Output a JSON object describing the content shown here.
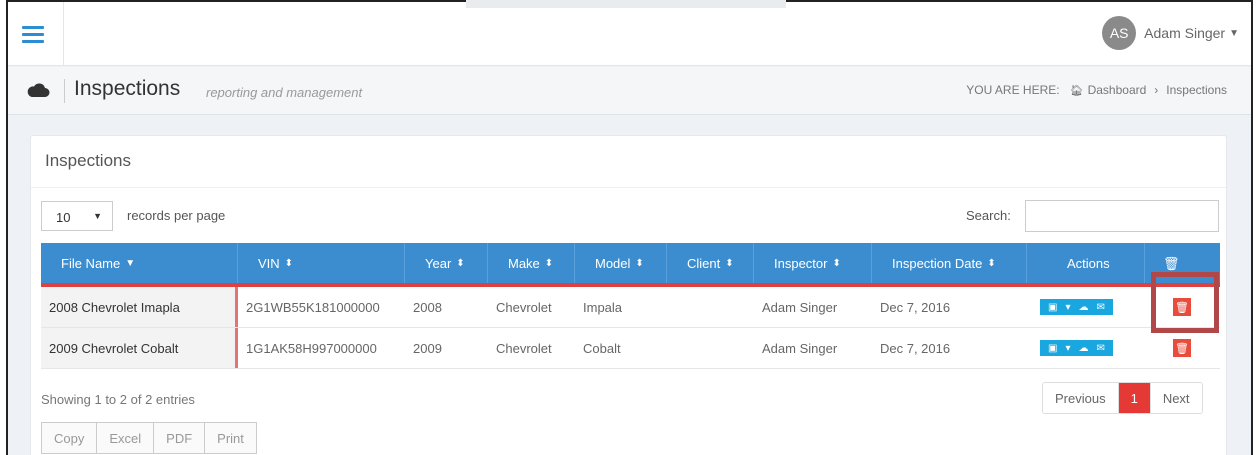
{
  "user": {
    "initials": "AS",
    "name": "Adam Singer"
  },
  "page": {
    "title": "Inspections",
    "subtitle": "reporting and management"
  },
  "breadcrumb": {
    "label": "YOU ARE HERE:",
    "items": [
      "Dashboard",
      "Inspections"
    ],
    "separator": "›"
  },
  "panel": {
    "title": "Inspections"
  },
  "table_controls": {
    "length_value": "10",
    "length_label": "records per page",
    "search_label": "Search:"
  },
  "columns": [
    "File Name",
    "VIN",
    "Year",
    "Make",
    "Model",
    "Client",
    "Inspector",
    "Inspection Date",
    "Actions",
    "🗑"
  ],
  "rows": [
    {
      "file_name": "2008 Chevrolet Imapla",
      "vin": "2G1WB55K181000000",
      "year": "2008",
      "make": "Chevrolet",
      "model": "Impala",
      "client": "",
      "inspector": "Adam Singer",
      "date": "Dec 7, 2016"
    },
    {
      "file_name": "2009 Chevrolet Cobalt",
      "vin": "1G1AK58H997000000",
      "year": "2009",
      "make": "Chevrolet",
      "model": "Cobalt",
      "client": "",
      "inspector": "Adam Singer",
      "date": "Dec 7, 2016"
    }
  ],
  "info_text": "Showing 1 to 2 of 2 entries",
  "pagination": {
    "prev": "Previous",
    "current": "1",
    "next": "Next"
  },
  "export_buttons": [
    "Copy",
    "Excel",
    "PDF",
    "Print"
  ],
  "colors": {
    "accent": "#3c8dd0",
    "danger": "#e84c3d",
    "info": "#1aa7e0",
    "highlight": "#b0484a"
  }
}
